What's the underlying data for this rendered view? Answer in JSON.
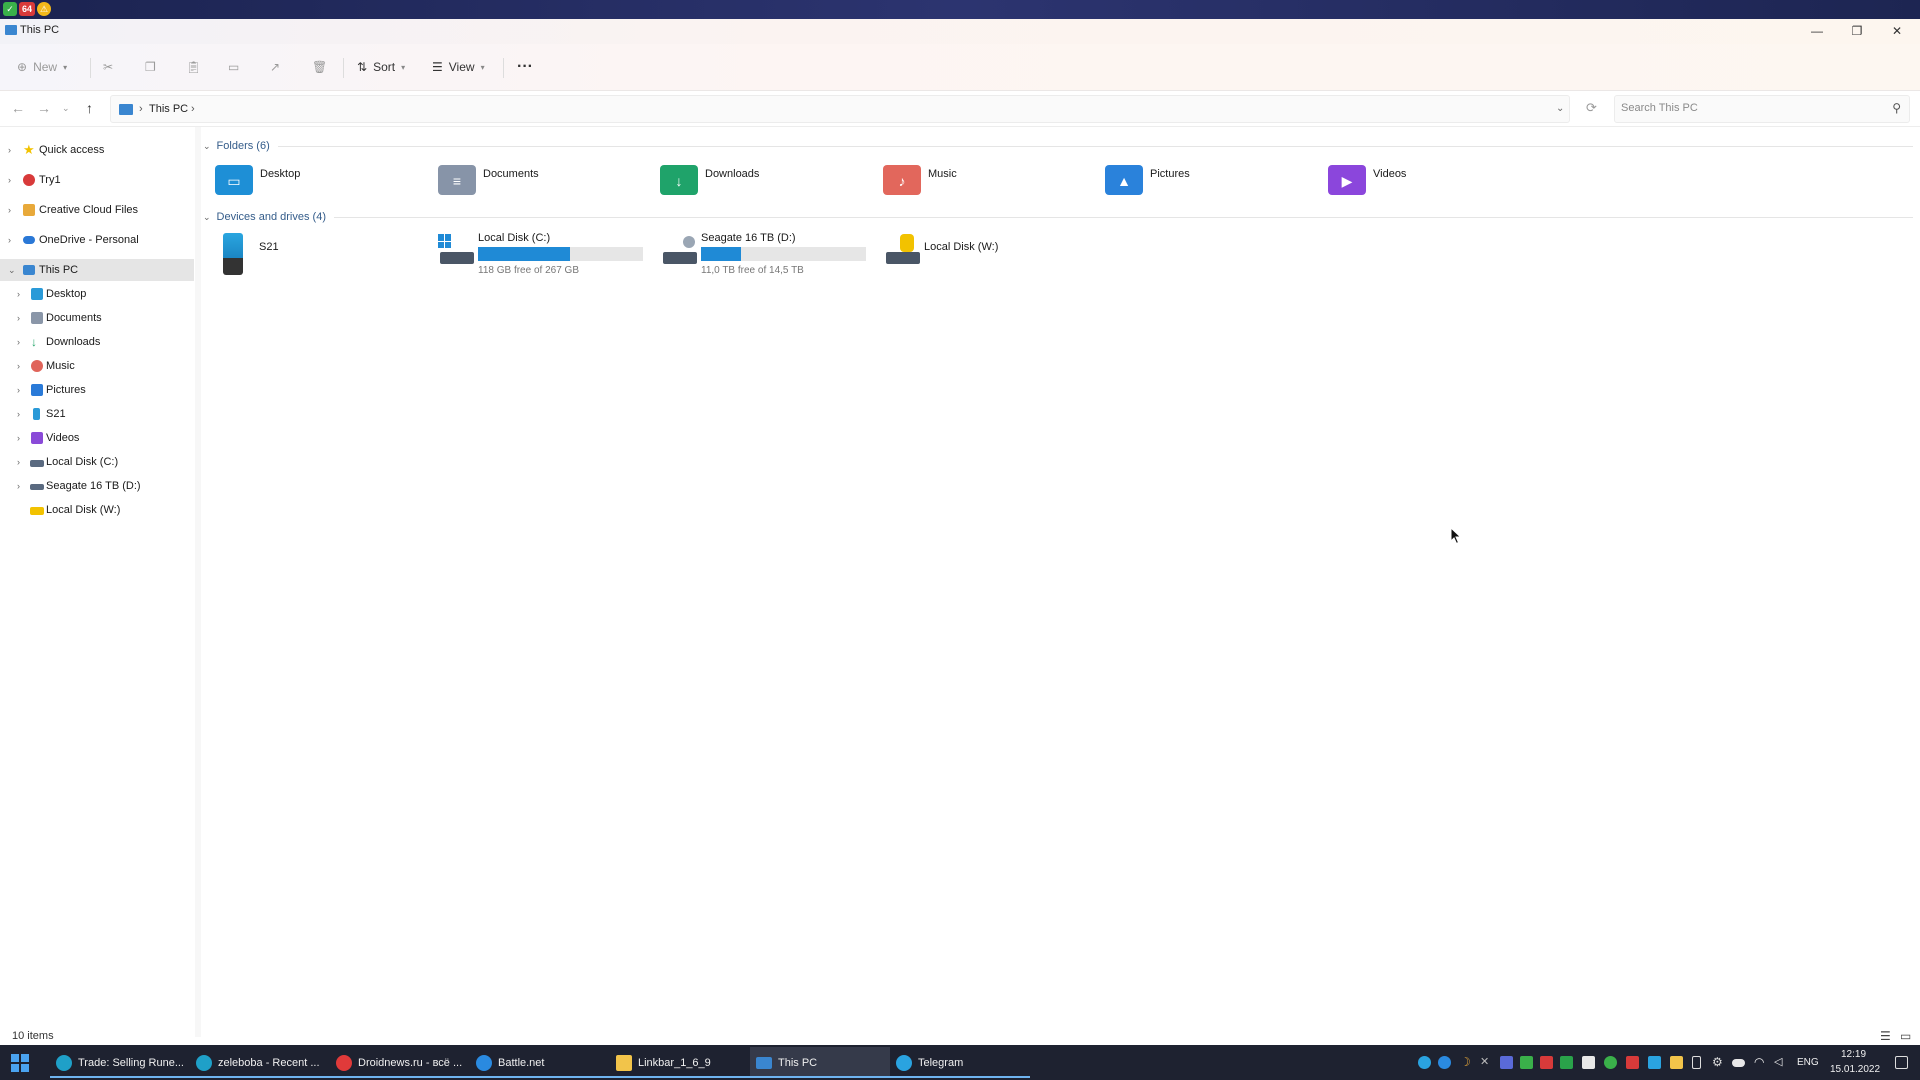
{
  "window": {
    "title": "This PC",
    "minimize_label": "—",
    "maximize_label": "❐",
    "close_label": "✕"
  },
  "toolbar": {
    "new_label": "New",
    "sort_label": "Sort",
    "view_label": "View",
    "more_label": "···"
  },
  "address": {
    "crumb": "This PC",
    "separator": "›",
    "search_placeholder": "Search This PC"
  },
  "sidebar": {
    "items": [
      {
        "label": "Quick access",
        "icon": "star-icon",
        "color": "#f2c200"
      },
      {
        "label": "Try1",
        "icon": "user-avatar-icon",
        "color": "#d83a3a"
      },
      {
        "label": "Creative Cloud Files",
        "icon": "creative-cloud-icon",
        "color": "#e8a93a"
      },
      {
        "label": "OneDrive - Personal",
        "icon": "onedrive-icon",
        "color": "#2a78d6"
      },
      {
        "label": "This PC",
        "icon": "computer-icon",
        "color": "#3a86d0"
      },
      {
        "label": "Desktop",
        "icon": "desktop-icon",
        "color": "#2a9ad8"
      },
      {
        "label": "Documents",
        "icon": "documents-icon",
        "color": "#8a96a8"
      },
      {
        "label": "Downloads",
        "icon": "downloads-icon",
        "color": "#26a56b"
      },
      {
        "label": "Music",
        "icon": "music-icon",
        "color": "#e0645a"
      },
      {
        "label": "Pictures",
        "icon": "pictures-icon",
        "color": "#2a7ad8"
      },
      {
        "label": "S21",
        "icon": "phone-icon",
        "color": "#2a9ad8"
      },
      {
        "label": "Videos",
        "icon": "videos-icon",
        "color": "#8a4ad8"
      },
      {
        "label": "Local Disk (C:)",
        "icon": "drive-icon",
        "color": "#5a6a80"
      },
      {
        "label": "Seagate 16 TB (D:)",
        "icon": "drive-icon",
        "color": "#5a6a80"
      },
      {
        "label": "Local Disk (W:)",
        "icon": "locked-drive-icon",
        "color": "#f2c200"
      }
    ]
  },
  "content": {
    "folders_header": "Folders (6)",
    "devices_header": "Devices and drives (4)",
    "folders": [
      {
        "label": "Desktop",
        "icon": "desktop-folder-icon",
        "color": "#1e8fd6",
        "glyph": "▭"
      },
      {
        "label": "Documents",
        "icon": "documents-folder-icon",
        "color": "#8794a8",
        "glyph": "≡"
      },
      {
        "label": "Downloads",
        "icon": "downloads-folder-icon",
        "color": "#1fa36a",
        "glyph": "↓"
      },
      {
        "label": "Music",
        "icon": "music-folder-icon",
        "color": "#e2675c",
        "glyph": "♪"
      },
      {
        "label": "Pictures",
        "icon": "pictures-folder-icon",
        "color": "#2a82db",
        "glyph": "▲"
      },
      {
        "label": "Videos",
        "icon": "videos-folder-icon",
        "color": "#8b46dc",
        "glyph": "▶"
      }
    ],
    "drives": [
      {
        "label": "S21",
        "free": "",
        "used_fraction": null,
        "icon": "phone-icon"
      },
      {
        "label": "Local Disk (C:)",
        "free": "118 GB free of 267 GB",
        "used_fraction": 0.56,
        "icon": "windows-drive-icon"
      },
      {
        "label": "Seagate 16 TB (D:)",
        "free": "11,0 TB free of 14,5 TB",
        "used_fraction": 0.24,
        "icon": "drive-icon"
      },
      {
        "label": "Local Disk (W:)",
        "free": "",
        "used_fraction": null,
        "icon": "locked-drive-icon"
      }
    ]
  },
  "status": {
    "item_count": "10 items"
  },
  "taskbar": {
    "tasks": [
      {
        "label": "Trade: Selling Rune...",
        "icon": "edge-icon",
        "color": "#1fa0c8",
        "active": false
      },
      {
        "label": "zeleboba - Recent ...",
        "icon": "edge-icon",
        "color": "#1fa0c8",
        "active": false
      },
      {
        "label": "Droidnews.ru - всё ...",
        "icon": "vivaldi-icon",
        "color": "#e03a3a",
        "active": false
      },
      {
        "label": "Battle.net",
        "icon": "battlenet-icon",
        "color": "#2a8ae0",
        "active": false
      },
      {
        "label": "Linkbar_1_6_9",
        "icon": "folder-icon",
        "color": "#f2c44a",
        "active": false
      },
      {
        "label": "This PC",
        "icon": "computer-icon",
        "color": "#3a86d0",
        "active": true
      },
      {
        "label": "Telegram",
        "icon": "telegram-icon",
        "color": "#2aa3e0",
        "active": false
      }
    ],
    "language": "ENG",
    "time": "12:19",
    "date": "15.01.2022"
  }
}
